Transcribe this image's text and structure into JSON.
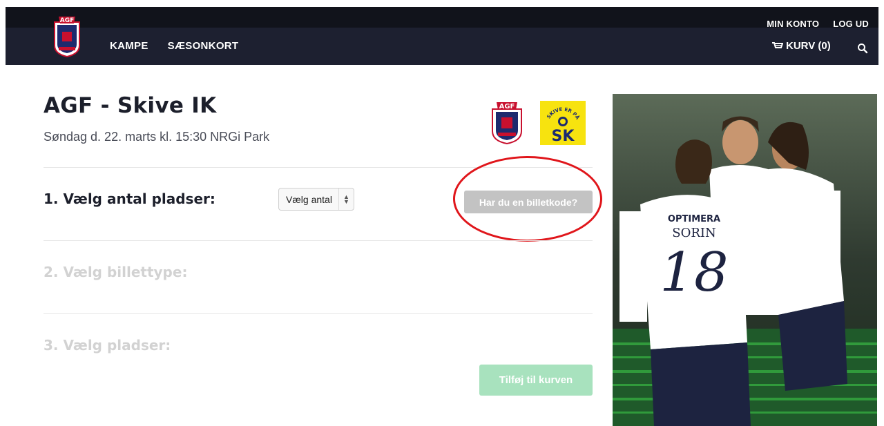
{
  "header": {
    "account_label": "MIN KONTO",
    "logout_label": "LOG UD",
    "nav": [
      "KAMPE",
      "SÆSONKORT"
    ],
    "cart_label": "KURV (0)"
  },
  "event": {
    "title": "AGF - Skive IK",
    "subtitle": "Søndag d. 22. marts kl. 15:30 NRGi Park",
    "home_logo_text": "AGF",
    "away_logo_text": "SK",
    "away_logo_tagline": "SKIVE ER PÅ VEJ"
  },
  "steps": {
    "step1": "1. Vælg antal pladser:",
    "step2": "2. Vælg billettype:",
    "step3": "3. Vælg pladser:"
  },
  "quantity_select": {
    "selected": "Vælg antal"
  },
  "code_button": "Har du en billetkode?",
  "add_to_cart_button": "Tilføj til kurven",
  "photo": {
    "shirt_sponsor": "OPTIMERA",
    "player_name": "SORIN",
    "player_number": "18"
  },
  "colors": {
    "topbar": "#11131b",
    "navbar": "#1d2030",
    "code_button": "#c3c3c3",
    "cart_button": "#a8e2be",
    "annotation": "#e0161b",
    "skive_yellow": "#f7e30f"
  }
}
